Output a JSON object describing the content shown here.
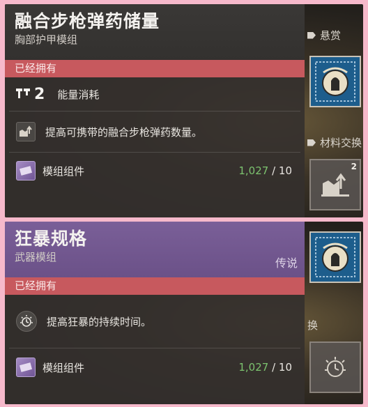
{
  "mod_a": {
    "title": "融合步枪弹药储量",
    "subtitle": "胸部护甲模组",
    "owned": "已经拥有",
    "energy_cost": "2",
    "energy_label": "能量消耗",
    "description": "提高可携带的融合步枪弹药数量。",
    "component_label": "模组组件",
    "component_have": "1,027",
    "component_sep": " / ",
    "component_need": "10"
  },
  "mod_b": {
    "title": "狂暴规格",
    "subtitle": "武器模组",
    "rarity": "传说",
    "owned": "已经拥有",
    "description": "提高狂暴的持续时间。",
    "component_label": "模组组件",
    "component_have": "1,027",
    "component_sep": " / ",
    "component_need": "10"
  },
  "side": {
    "bounties_label": "悬赏",
    "materials_label": "材料交换",
    "materials_fragment": "换",
    "material_badge": "2"
  },
  "colors": {
    "owned_bar": "#c7595e",
    "legendary_header": "#6b5188",
    "count_green": "#7cc36f",
    "bounty_blue": "#1d5d8c",
    "background_pink": "#f6b9cb"
  },
  "icons": {
    "energy": "energy-cost-icon",
    "armor_mod": "armor-mod-icon",
    "rampage_mod": "stopwatch-icon",
    "component": "mod-component-icon",
    "bounty": "bounty-eye-icon"
  }
}
